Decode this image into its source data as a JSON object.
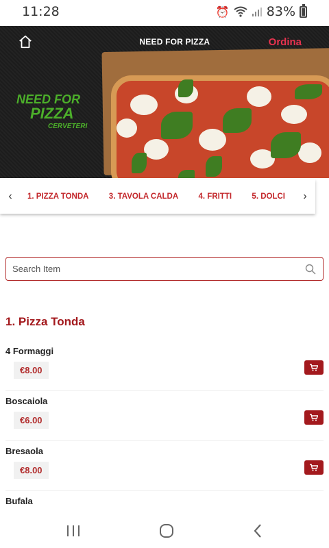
{
  "status_bar": {
    "time": "11:28",
    "battery": "83%"
  },
  "header": {
    "brand": "NEED FOR PIZZA",
    "order_label": "Ordina"
  },
  "logo": {
    "line1": "NEED FOR",
    "line2": "PIZZA",
    "line3": "CERVETERI"
  },
  "categories": {
    "prev": "‹",
    "next": "›",
    "items": [
      "1. PIZZA TONDA",
      "3. TAVOLA CALDA",
      "4. FRITTI",
      "5. DOLCI"
    ]
  },
  "search": {
    "placeholder": "Search Item"
  },
  "section": {
    "title": "1. Pizza Tonda"
  },
  "menu_items": [
    {
      "name": "4 Formaggi",
      "price": "€8.00"
    },
    {
      "name": "Boscaiola",
      "price": "€6.00"
    },
    {
      "name": "Bresaola",
      "price": "€8.00"
    },
    {
      "name": "Bufala",
      "price": ""
    }
  ],
  "colors": {
    "accent": "#a3191d",
    "brand_pink": "#e8334f",
    "logo_green": "#4caf2a"
  },
  "icons": [
    "home-icon",
    "cart-icon",
    "search-icon",
    "recent-apps-icon",
    "home-button-icon",
    "back-icon"
  ]
}
